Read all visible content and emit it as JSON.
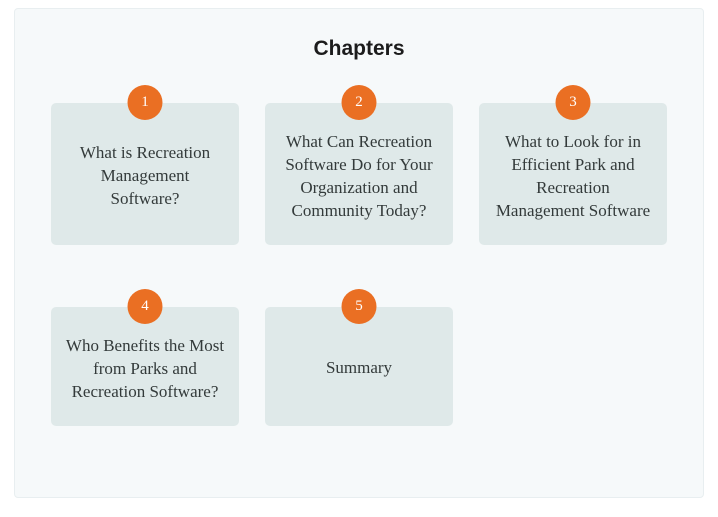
{
  "heading": "Chapters",
  "chapters": [
    {
      "num": "1",
      "title": "What is Recreation Management Software?"
    },
    {
      "num": "2",
      "title": "What Can Recreation Software Do for Your Organization and Community Today?"
    },
    {
      "num": "3",
      "title": "What to Look for in Efficient Park and Recreation Management Software"
    },
    {
      "num": "4",
      "title": "Who Benefits the Most from Parks and Recreation Software?"
    },
    {
      "num": "5",
      "title": "Summary"
    }
  ]
}
